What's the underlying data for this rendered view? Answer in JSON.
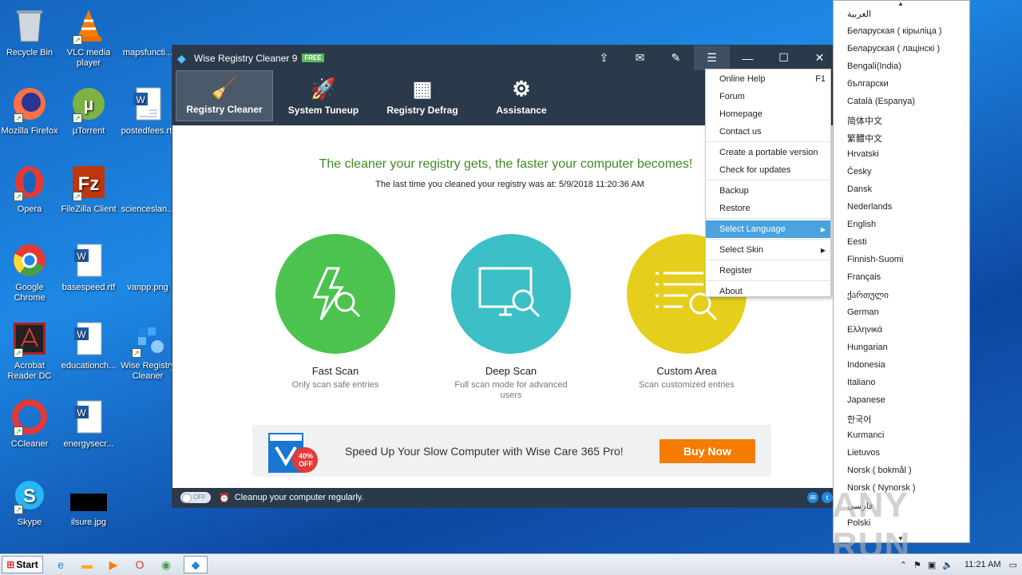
{
  "desktop": {
    "icons": [
      {
        "label": "Recycle Bin"
      },
      {
        "label": "VLC media player"
      },
      {
        "label": "mapsfuncti..."
      },
      {
        "label": "Mozilla Firefox"
      },
      {
        "label": "µTorrent"
      },
      {
        "label": "postedfees.rtf"
      },
      {
        "label": "Opera"
      },
      {
        "label": "FileZilla Client"
      },
      {
        "label": "scienceslan..."
      },
      {
        "label": "Google Chrome"
      },
      {
        "label": "basespeed.rtf"
      },
      {
        "label": "vanpp.png"
      },
      {
        "label": "Acrobat Reader DC"
      },
      {
        "label": "educationch..."
      },
      {
        "label": "Wise Registry Cleaner"
      },
      {
        "label": "CCleaner"
      },
      {
        "label": "energysecr..."
      },
      {
        "label": "Skype"
      },
      {
        "label": "ilsure.jpg"
      }
    ]
  },
  "window": {
    "title": "Wise Registry Cleaner 9",
    "badge": "FREE"
  },
  "toolbar": {
    "items": [
      {
        "label": "Registry Cleaner",
        "icon": "broom-icon"
      },
      {
        "label": "System Tuneup",
        "icon": "rocket-icon"
      },
      {
        "label": "Registry Defrag",
        "icon": "blocks-icon"
      },
      {
        "label": "Assistance",
        "icon": "gear-wrench-icon"
      }
    ]
  },
  "main": {
    "headline": "The cleaner your registry gets, the faster your computer becomes!",
    "last_clean": "The last time you cleaned your registry was at: 5/9/2018 11:20:36 AM",
    "scans": [
      {
        "name": "Fast Scan",
        "desc": "Only scan safe entries",
        "color": "#4cc34f"
      },
      {
        "name": "Deep Scan",
        "desc": "Full scan mode for advanced users",
        "color": "#3cbfc7"
      },
      {
        "name": "Custom Area",
        "desc": "Scan customized entries",
        "color": "#e6cf1c"
      }
    ],
    "banner": {
      "text": "Speed Up Your Slow Computer with Wise Care 365 Pro!",
      "badge": "40% OFF",
      "button": "Buy Now"
    }
  },
  "status": {
    "toggle": "OFF",
    "text": "Cleanup your computer regularly."
  },
  "menu": {
    "items": [
      {
        "label": "Online Help",
        "key": "F1"
      },
      {
        "label": "Forum"
      },
      {
        "label": "Homepage"
      },
      {
        "label": "Contact us"
      },
      {
        "label": "Create a portable version"
      },
      {
        "label": "Check for updates"
      },
      {
        "label": "Backup"
      },
      {
        "label": "Restore"
      },
      {
        "label": "Select Language"
      },
      {
        "label": "Select Skin"
      },
      {
        "label": "Register"
      },
      {
        "label": "About"
      }
    ]
  },
  "languages": [
    "العربية",
    "Беларуская ( кірыліца )",
    "Беларуская ( лацінскі )",
    "Bengali(India)",
    "български",
    "Català (Espanya)",
    "简体中文",
    "繁體中文",
    "Hrvatski",
    "Česky",
    "Dansk",
    "Nederlands",
    "English",
    "Eesti",
    "Finnish-Suomi",
    "Français",
    "ქართული",
    "German",
    "Ελληνικά",
    "Hungarian",
    "Indonesia",
    "Italiano",
    "Japanese",
    "한국어",
    "Kurmanci",
    "Lietuvos",
    "Norsk ( bokmål )",
    "Norsk ( Nynorsk )",
    "فارسی",
    "Polski"
  ],
  "watermark": "ANY RUN",
  "taskbar": {
    "start": "Start",
    "clock": "11:21 AM"
  }
}
